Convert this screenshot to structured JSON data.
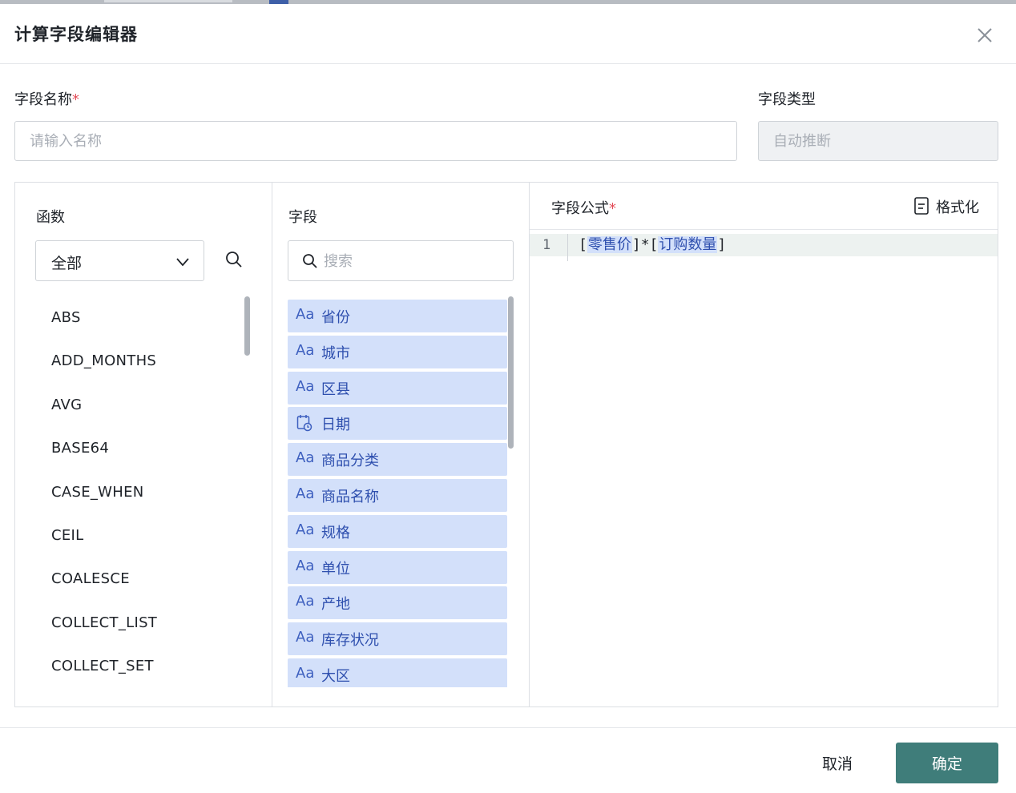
{
  "dialog": {
    "title": "计算字段编辑器"
  },
  "form": {
    "name_label": "字段名称",
    "required_mark": "*",
    "name_placeholder": "请输入名称",
    "type_label": "字段类型",
    "type_placeholder": "自动推断"
  },
  "functions": {
    "title": "函数",
    "filter_selected": "全部",
    "items": [
      "ABS",
      "ADD_MONTHS",
      "AVG",
      "BASE64",
      "CASE_WHEN",
      "CEIL",
      "COALESCE",
      "COLLECT_LIST",
      "COLLECT_SET"
    ]
  },
  "fields": {
    "title": "字段",
    "search_placeholder": "搜索",
    "items": [
      {
        "type": "text",
        "type_label": "Aa",
        "name": "省份"
      },
      {
        "type": "text",
        "type_label": "Aa",
        "name": "城市"
      },
      {
        "type": "text",
        "type_label": "Aa",
        "name": "区县"
      },
      {
        "type": "date",
        "type_label": "",
        "name": "日期"
      },
      {
        "type": "text",
        "type_label": "Aa",
        "name": "商品分类"
      },
      {
        "type": "text",
        "type_label": "Aa",
        "name": "商品名称"
      },
      {
        "type": "text",
        "type_label": "Aa",
        "name": "规格"
      },
      {
        "type": "text",
        "type_label": "Aa",
        "name": "单位"
      },
      {
        "type": "text",
        "type_label": "Aa",
        "name": "产地"
      },
      {
        "type": "text",
        "type_label": "Aa",
        "name": "库存状况"
      },
      {
        "type": "text",
        "type_label": "Aa",
        "name": "大区"
      }
    ]
  },
  "formula": {
    "title": "字段公式",
    "format_label": "格式化",
    "line_number": "1",
    "tokens": [
      "[",
      "零售价",
      "]",
      "*",
      "[",
      "订购数量",
      "]"
    ]
  },
  "footer": {
    "cancel_label": "取消",
    "ok_label": "确定"
  },
  "colors": {
    "primary": "#3f7d7a",
    "field_chip_bg": "#d3e0fa",
    "field_chip_text": "#2e4fae",
    "required": "#e34d59"
  }
}
